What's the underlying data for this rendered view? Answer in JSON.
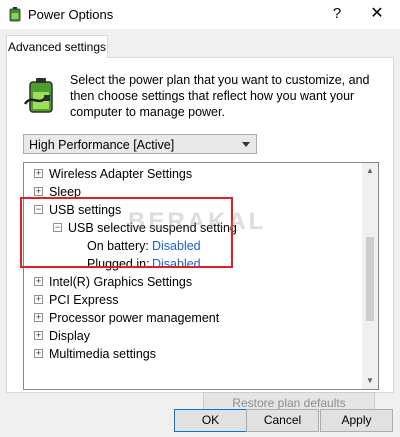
{
  "window": {
    "title": "Power Options",
    "help_glyph": "?",
    "close_glyph": "✕",
    "icon": "power-options-icon"
  },
  "tab": {
    "label": "Advanced settings"
  },
  "description": "Select the power plan that you want to customize, and then choose settings that reflect how you want your computer to manage power.",
  "plan_select": {
    "value": "High Performance [Active]"
  },
  "tree": {
    "rows": [
      {
        "id": "wireless",
        "label": "Wireless Adapter Settings",
        "expander": "+"
      },
      {
        "id": "sleep",
        "label": "Sleep",
        "expander": "+"
      },
      {
        "id": "usb",
        "label": "USB settings",
        "expander": "−"
      },
      {
        "id": "usb-selective",
        "label": "USB selective suspend setting",
        "expander": "−"
      },
      {
        "id": "on-battery",
        "label": "On battery:",
        "value": "Disabled"
      },
      {
        "id": "plugged-in",
        "label": "Plugged in:",
        "value": "Disabled"
      },
      {
        "id": "intel-graphics",
        "label": "Intel(R) Graphics Settings",
        "expander": "+"
      },
      {
        "id": "pci-express",
        "label": "PCI Express",
        "expander": "+"
      },
      {
        "id": "processor",
        "label": "Processor power management",
        "expander": "+"
      },
      {
        "id": "display",
        "label": "Display",
        "expander": "+"
      },
      {
        "id": "multimedia",
        "label": "Multimedia settings",
        "expander": "+"
      }
    ]
  },
  "scrollbar": {
    "up_glyph": "▲",
    "down_glyph": "▼"
  },
  "watermark": "BERAKAL",
  "restore_button": "Restore plan defaults",
  "buttons": {
    "ok": "OK",
    "cancel": "Cancel",
    "apply": "Apply"
  },
  "colors": {
    "highlight_border": "#e31e24",
    "link_value": "#1a5fd6"
  }
}
